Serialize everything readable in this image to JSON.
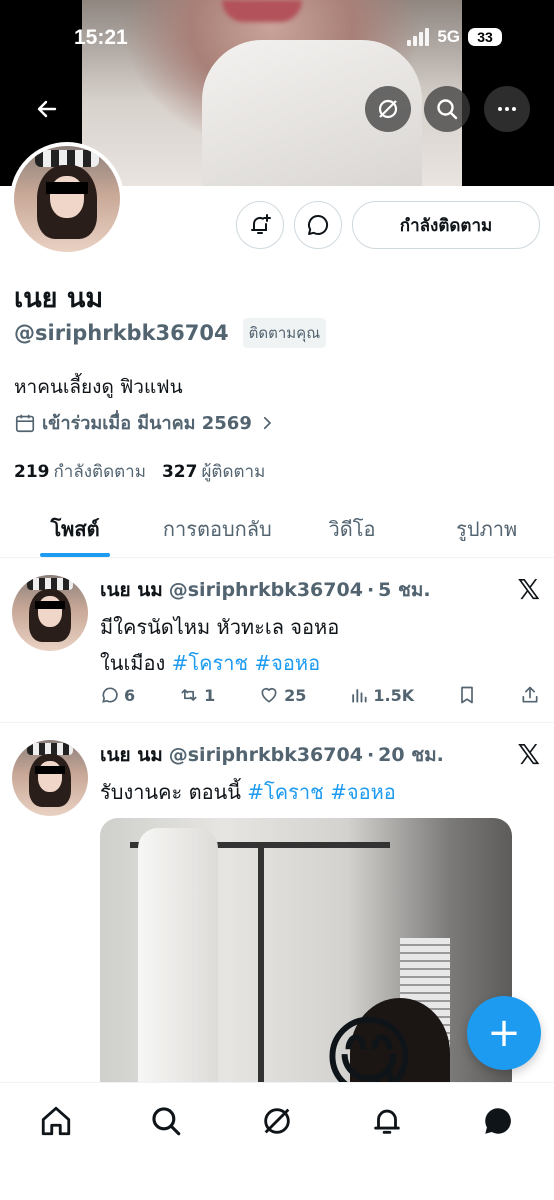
{
  "status_bar": {
    "time": "15:21",
    "network": "5G",
    "battery": "33"
  },
  "header": {
    "icons": [
      "back-arrow-icon",
      "grok-icon",
      "search-icon",
      "more-icon"
    ]
  },
  "profile": {
    "display_name": "เนย นม",
    "handle": "@siriphrkbk36704",
    "follows_you": "ติดตามคุณ",
    "bio": "หาคนเลี้ยงดู ฟิวแฟน",
    "joined": "เข้าร่วมเมื่อ มีนาคม 2569",
    "following_count": "219",
    "following_label": "กำลังติดตาม",
    "followers_count": "327",
    "followers_label": "ผู้ติดตาม",
    "follow_button": "กำลังติดตาม"
  },
  "tabs": [
    {
      "label": "โพสต์",
      "active": true
    },
    {
      "label": "การตอบกลับ",
      "active": false
    },
    {
      "label": "วิดีโอ",
      "active": false
    },
    {
      "label": "รูปภาพ",
      "active": false
    }
  ],
  "posts": [
    {
      "name": "เนย นม",
      "handle": "@siriphrkbk36704",
      "sep": "·",
      "time": "5 ชม.",
      "x_logo": "𝕏",
      "text_line1": "มีใครนัดไหม หัวทะเล จอหอ",
      "text_line2_prefix": "ในเมือง",
      "hashtag1": "#โคราช",
      "hashtag2": "#จอหอ",
      "replies": "6",
      "reposts": "1",
      "likes": "25",
      "views": "1.5K"
    },
    {
      "name": "เนย นม",
      "handle": "@siriphrkbk36704",
      "sep": "·",
      "time": "20 ชม.",
      "x_logo": "𝕏",
      "text_prefix": "รับงานคะ ตอนนี้",
      "hashtag1": "#โคราช",
      "hashtag2": "#จอหอ",
      "media_emoji": "😋"
    }
  ],
  "fab": {
    "label": "+"
  },
  "bottom_nav": [
    "home-icon",
    "search-icon",
    "grok-icon",
    "notifications-icon",
    "messages-icon"
  ]
}
